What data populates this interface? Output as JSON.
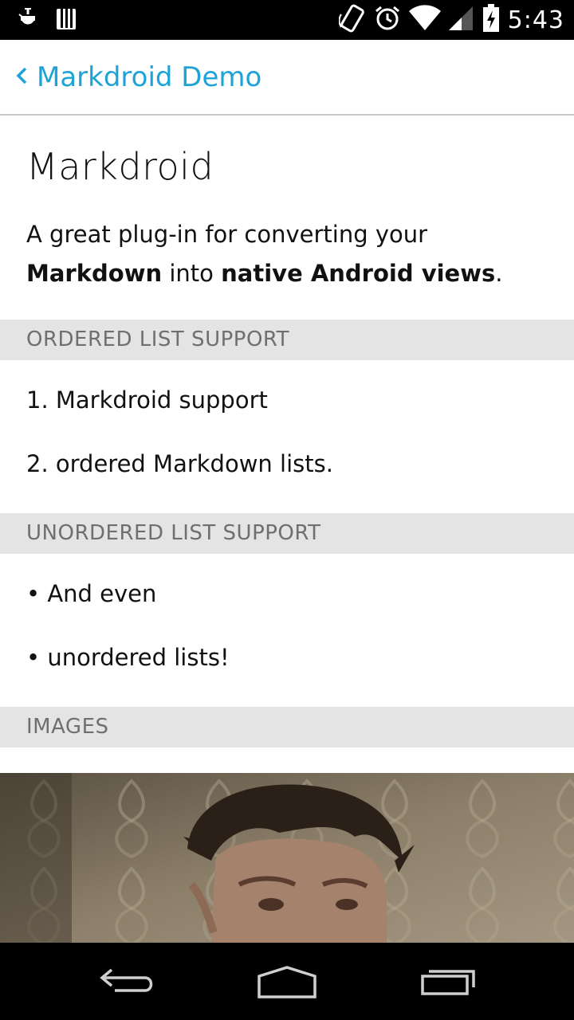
{
  "status_bar": {
    "time": "5:43",
    "left_icons": [
      "usb-debug-icon",
      "storage-icon"
    ],
    "right_icons": [
      "screen-rotation-icon",
      "alarm-icon",
      "wifi-icon",
      "cell-signal-icon",
      "battery-charging-icon"
    ]
  },
  "action_bar": {
    "title": "Markdroid Demo"
  },
  "content": {
    "heading": "Markdroid",
    "paragraph": {
      "part1": "A great plug-in for converting your ",
      "bold1": "Markdown",
      "part2": " into ",
      "bold2": "native Android views",
      "part3": "."
    },
    "sections": [
      {
        "title": "ORDERED LIST SUPPORT",
        "items": [
          "1. Markdroid support",
          "2. ordered Markdown lists."
        ]
      },
      {
        "title": "UNORDERED LIST SUPPORT",
        "items": [
          "• And even",
          "• unordered lists!"
        ]
      },
      {
        "title": "IMAGES",
        "items": []
      }
    ]
  },
  "nav_bar": {
    "buttons": [
      "back-button",
      "home-button",
      "recents-button"
    ]
  }
}
